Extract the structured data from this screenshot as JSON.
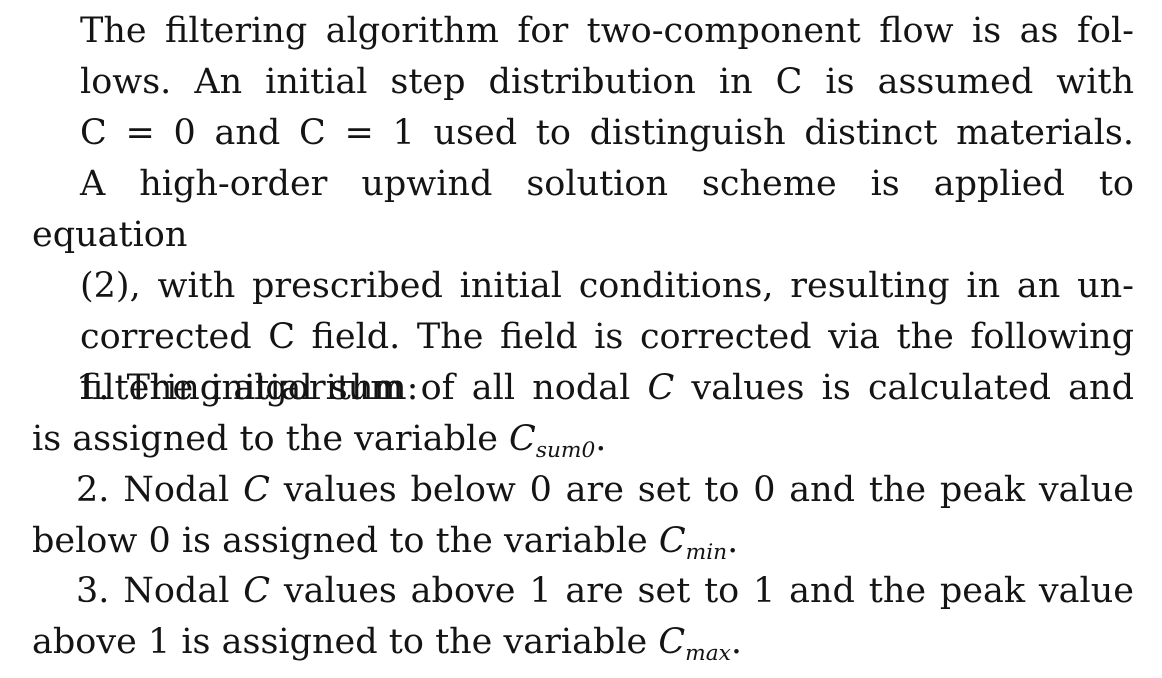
{
  "intro": {
    "lines": [
      "The filtering algorithm for two-component flow is as fol-",
      "lows.  An initial step distribution in C is assumed with",
      "C = 0 and C = 1 used to distinguish distinct materials.",
      "A high-order upwind solution scheme is applied to equation",
      "(2), with prescribed initial conditions, resulting in an un-",
      "corrected C field.  The field is corrected via the following",
      "filtering algorithm:"
    ]
  },
  "items": [
    {
      "number": "1.",
      "line1": "The initial sum of all nodal C values is calculated and",
      "line2_prefix": "is assigned to the variable ",
      "var": "C",
      "var_sub": "sum0",
      "end": "."
    },
    {
      "number": "2.",
      "line1": "Nodal C values below 0 are set to 0 and the peak value",
      "line2_prefix": "below 0 is assigned to the variable ",
      "var": "C",
      "var_sub": "min",
      "end": "."
    },
    {
      "number": "3.",
      "line1": "Nodal C values above 1 are set to 1 and the peak value",
      "line2_prefix": "above 1 is assigned to the variable ",
      "var": "C",
      "var_sub": "max",
      "end": "."
    }
  ]
}
